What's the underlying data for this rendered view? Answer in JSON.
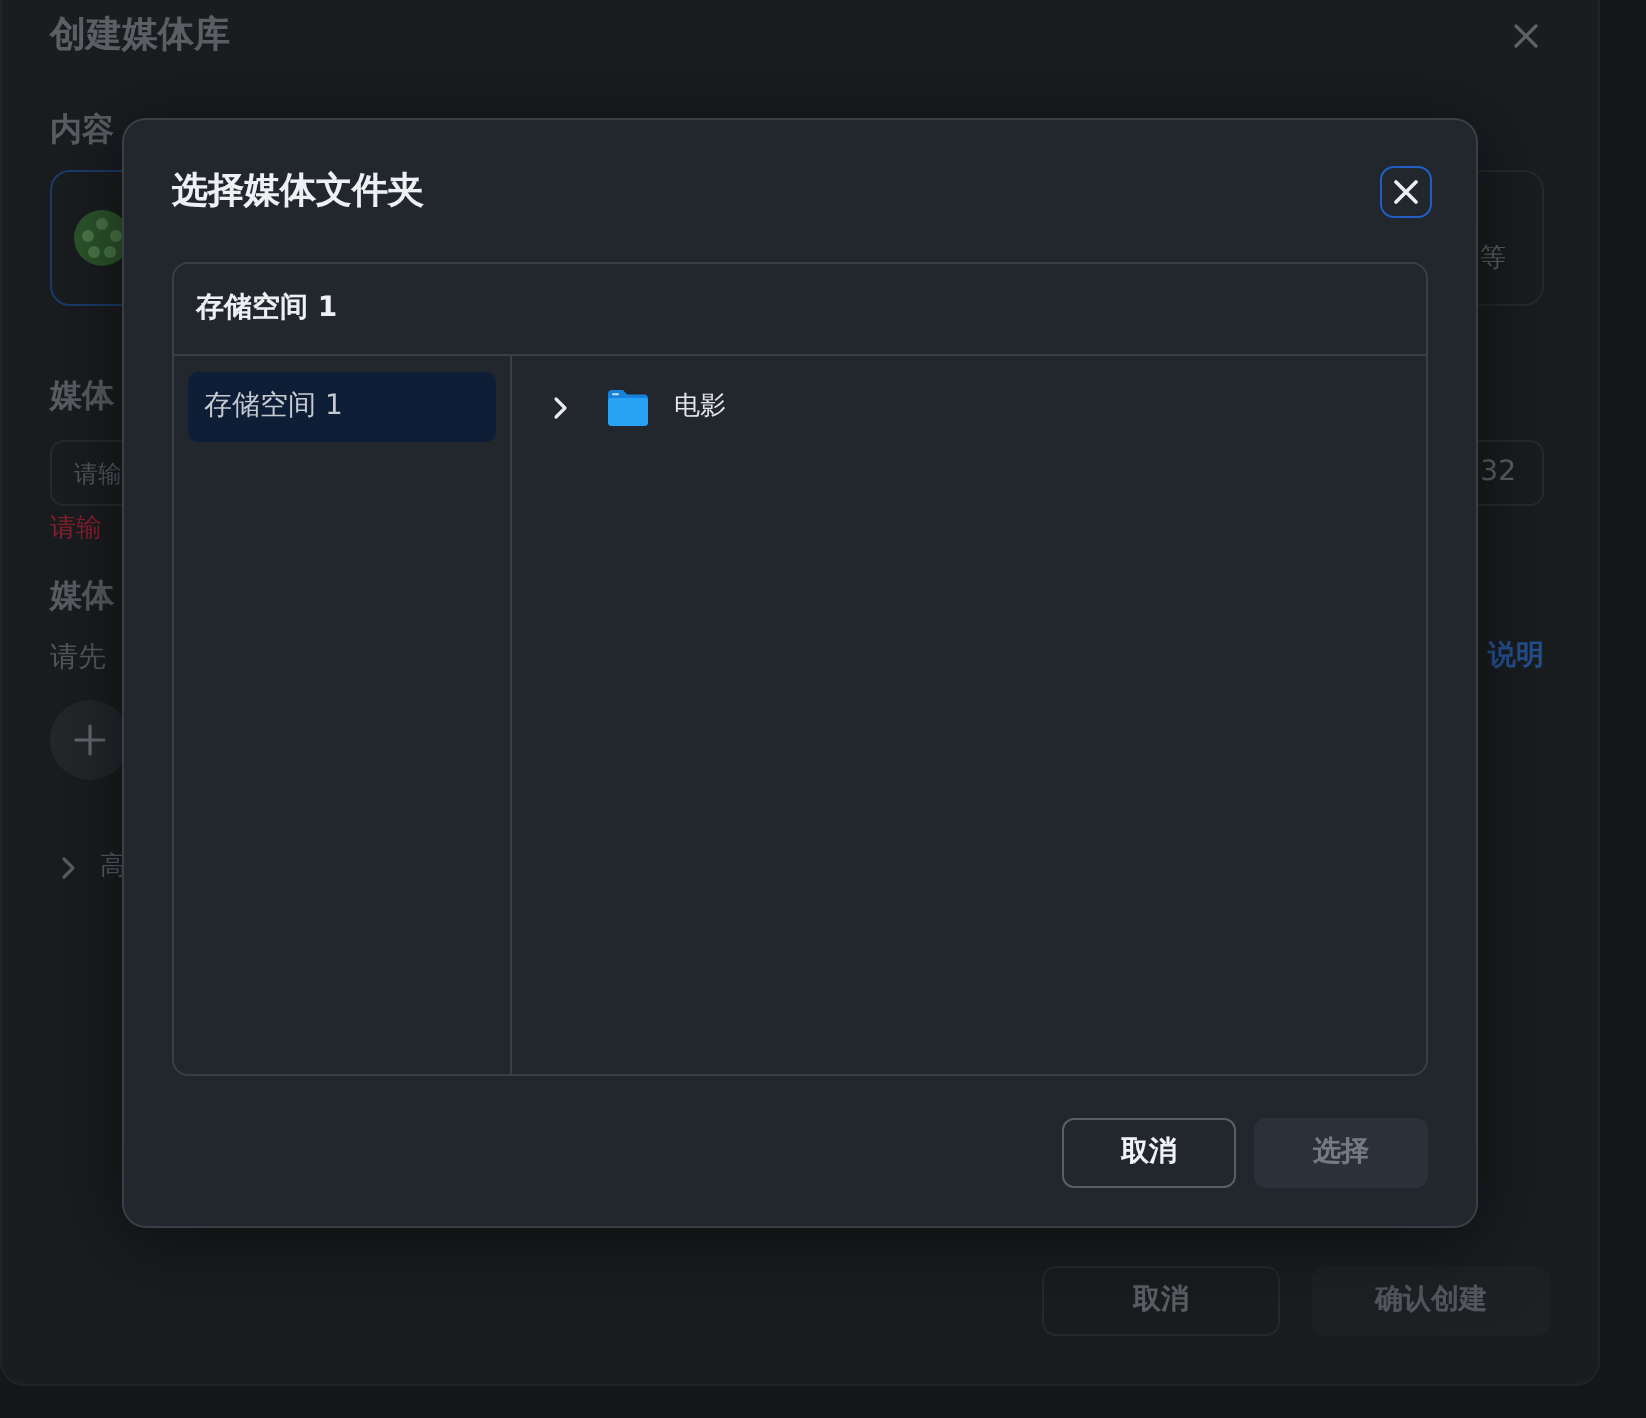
{
  "background_dialog": {
    "title": "创建媒体库",
    "content_type": {
      "label": "内容",
      "cards": [
        {
          "selected": true
        },
        {
          "description": "等",
          "selected": false
        }
      ]
    },
    "name_field": {
      "label": "媒体",
      "placeholder": "请输",
      "counter": "32",
      "error": "请输"
    },
    "folder_section": {
      "label": "媒体",
      "hint": "请先",
      "help_link": "说明"
    },
    "advanced": {
      "label": "高",
      "expanded": false
    },
    "buttons": [
      {
        "label": "取消",
        "kind": "secondary",
        "disabled": false
      },
      {
        "label": "确认创建",
        "kind": "primary",
        "disabled": true
      }
    ]
  },
  "folder_dialog": {
    "title": "选择媒体文件夹",
    "panel_title": "存储空间 1",
    "storages": [
      {
        "label": "存储空间 1",
        "selected": true
      }
    ],
    "folders": [
      {
        "name": "电影",
        "expanded": false
      }
    ],
    "buttons": [
      {
        "label": "取消",
        "kind": "secondary",
        "disabled": false
      },
      {
        "label": "选择",
        "kind": "primary",
        "disabled": true
      }
    ]
  }
}
